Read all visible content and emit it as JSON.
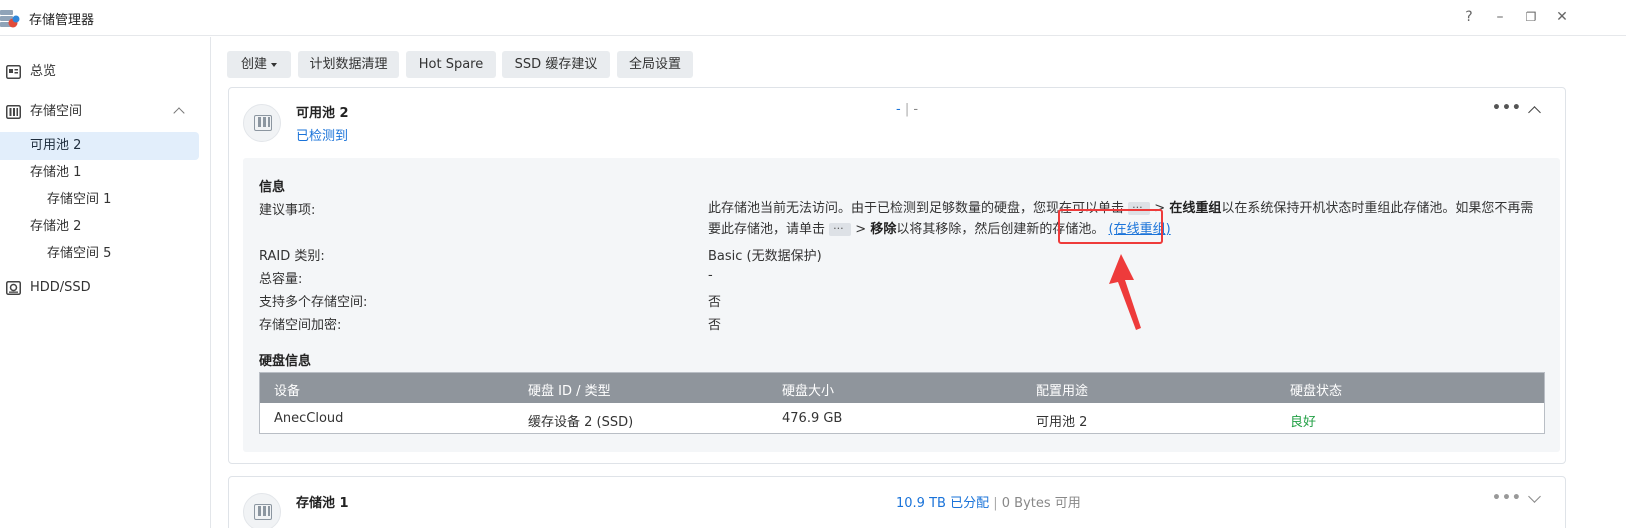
{
  "app": {
    "title": "存储管理器",
    "controls": {
      "help": "?",
      "minimize": "–",
      "restore": "❐",
      "close": "✕"
    }
  },
  "sidebar": {
    "items": [
      {
        "label": "总览",
        "icon": "overview-icon"
      },
      {
        "label": "存储空间",
        "icon": "storage-icon"
      },
      {
        "label": "可用池 2"
      },
      {
        "label": "存储池 1"
      },
      {
        "label": "存储空间 1"
      },
      {
        "label": "存储池 2"
      },
      {
        "label": "存储空间 5"
      },
      {
        "label": "HDD/SSD",
        "icon": "disk-icon"
      }
    ]
  },
  "toolbar": {
    "create_label": "创建",
    "schedule_label": "计划数据清理",
    "hotspare_label": "Hot Spare",
    "ssd_label": "SSD 缓存建议",
    "global_label": "全局设置"
  },
  "pool": {
    "name": "可用池 2",
    "status": "已检测到",
    "usage_left": "-",
    "usage_sep": "|",
    "usage_right": "-",
    "info_title": "信息",
    "labels": {
      "advice": "建议事项:",
      "raid": "RAID 类别:",
      "capacity": "总容量:",
      "multi": "支持多个存储空间:",
      "encrypt": "存储空间加密:"
    },
    "advice": {
      "p1": "此存储池当前无法访问。由于已检测到足够数量的硬盘，您现在可以单击",
      "p2": ">",
      "p3": "在线重组",
      "p4": "以在系统保持开机状态时重组此存储池。如果您不再需要此存储池，请单击",
      "p5": ">",
      "p6": "移除",
      "p7": "以将其移除，然后创建新的存储池。",
      "link": "(在线重组)"
    },
    "raid": "Basic (无数据保护)",
    "capacity": "-",
    "multi": "否",
    "encrypt": "否",
    "disk_title": "硬盘信息",
    "disk_headers": [
      "设备",
      "硬盘 ID / 类型",
      "硬盘大小",
      "配置用途",
      "硬盘状态"
    ],
    "disk_row": [
      "AnecCloud",
      "缓存设备 2 (SSD)",
      "476.9 GB",
      "可用池 2",
      "良好"
    ]
  },
  "pool2": {
    "name": "存储池 1",
    "allocated": "10.9 TB 已分配",
    "sep": "|",
    "available": "0 Bytes 可用"
  },
  "colors": {
    "accent": "#1a73d9",
    "good": "#23a046",
    "highlight": "#ee3b3b"
  }
}
